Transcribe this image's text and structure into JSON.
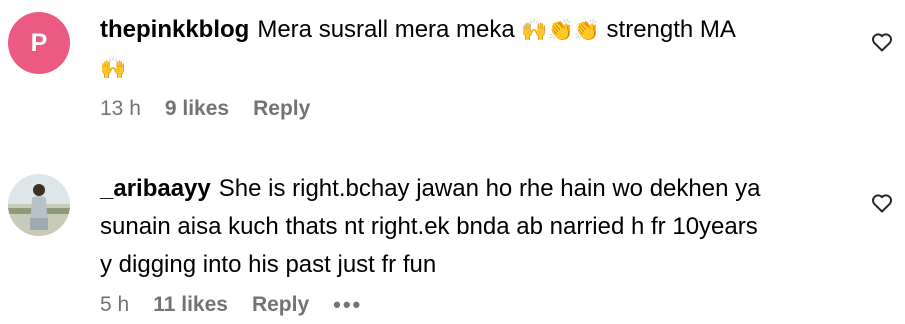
{
  "comments": [
    {
      "avatar_letter": "P",
      "username": "thepinkkblog",
      "text_before": "Mera susrall mera meka",
      "emojis": "🙌👏👏",
      "text_after": "strength MA",
      "emoji_line2": "🙌",
      "time": "13 h",
      "likes": "9 likes",
      "reply": "Reply",
      "icons": {
        "like": "heart-outline-icon"
      }
    },
    {
      "username": "_aribaayy",
      "line1": "She is right.bchay jawan ho rhe hain wo dekhen ya",
      "line2": "sunain aisa kuch thats nt right.ek bnda ab narried h fr 10years",
      "line3": "y digging into his past just fr fun",
      "time": "5 h",
      "likes": "11 likes",
      "reply": "Reply",
      "more": "•••",
      "icons": {
        "like": "heart-outline-icon",
        "more": "more-options-icon"
      }
    }
  ]
}
